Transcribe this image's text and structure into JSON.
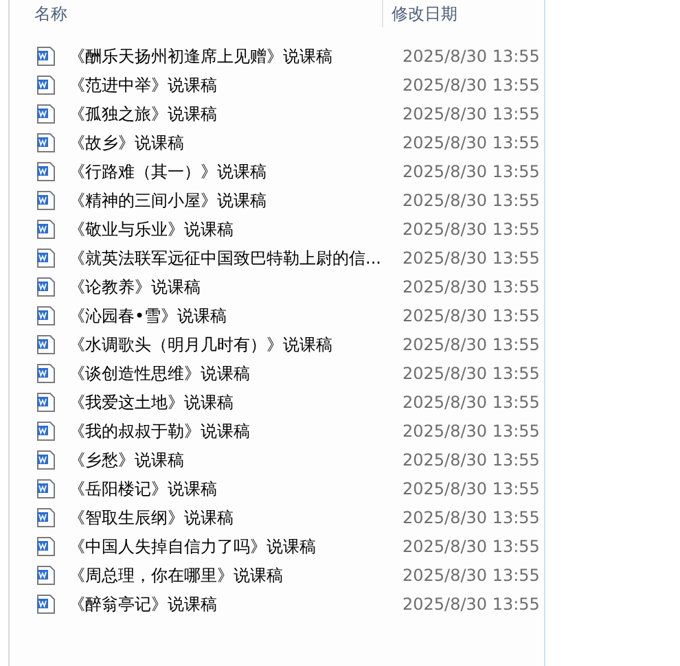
{
  "columns": [
    {
      "label": "名称"
    },
    {
      "label": "修改日期"
    }
  ],
  "files": [
    {
      "name": "《酬乐天扬州初逢席上见赠》说课稿",
      "modified": "2025/8/30 13:55"
    },
    {
      "name": "《范进中举》说课稿",
      "modified": "2025/8/30 13:55"
    },
    {
      "name": "《孤独之旅》说课稿",
      "modified": "2025/8/30 13:55"
    },
    {
      "name": "《故乡》说课稿",
      "modified": "2025/8/30 13:55"
    },
    {
      "name": "《行路难（其一）》说课稿",
      "modified": "2025/8/30 13:55"
    },
    {
      "name": "《精神的三间小屋》说课稿",
      "modified": "2025/8/30 13:55"
    },
    {
      "name": "《敬业与乐业》说课稿",
      "modified": "2025/8/30 13:55"
    },
    {
      "name": "《就英法联军远征中国致巴特勒上尉的信...",
      "modified": "2025/8/30 13:55"
    },
    {
      "name": "《论教养》说课稿",
      "modified": "2025/8/30 13:55"
    },
    {
      "name": "《沁园春•雪》说课稿",
      "modified": "2025/8/30 13:55"
    },
    {
      "name": "《水调歌头（明月几时有）》说课稿",
      "modified": "2025/8/30 13:55"
    },
    {
      "name": "《谈创造性思维》说课稿",
      "modified": "2025/8/30 13:55"
    },
    {
      "name": "《我爱这土地》说课稿",
      "modified": "2025/8/30 13:55"
    },
    {
      "name": "《我的叔叔于勒》说课稿",
      "modified": "2025/8/30 13:55"
    },
    {
      "name": "《乡愁》说课稿",
      "modified": "2025/8/30 13:55"
    },
    {
      "name": "《岳阳楼记》说课稿",
      "modified": "2025/8/30 13:55"
    },
    {
      "name": "《智取生辰纲》说课稿",
      "modified": "2025/8/30 13:55"
    },
    {
      "name": "《中国人失掉自信力了吗》说课稿",
      "modified": "2025/8/30 13:55"
    },
    {
      "name": "《周总理，你在哪里》说课稿",
      "modified": "2025/8/30 13:55"
    },
    {
      "name": "《醉翁亭记》说课稿",
      "modified": "2025/8/30 13:55"
    }
  ]
}
